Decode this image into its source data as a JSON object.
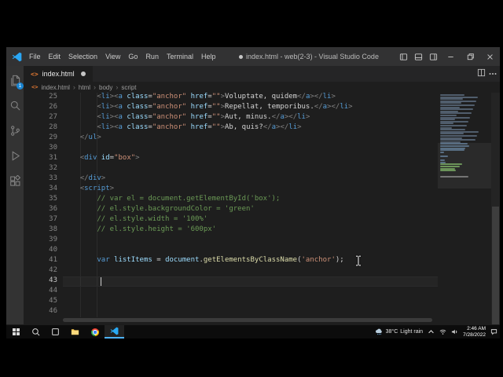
{
  "colors": {
    "accent_blue": "#007acc",
    "badge_blue": "#1a85d2",
    "html_icon_orange": "#e37933",
    "token_tag": "#569cd6",
    "token_attr": "#9cdcfe",
    "token_string": "#ce9178",
    "token_punct": "#808080",
    "token_plain": "#d4d4d4",
    "token_comment": "#6a9955",
    "token_keyword": "#569cd6",
    "token_variable": "#9cdcfe",
    "token_function": "#dcdcaa"
  },
  "window": {
    "title": "index.html - web(2-3) - Visual Studio Code"
  },
  "menu_bar": [
    "File",
    "Edit",
    "Selection",
    "View",
    "Go",
    "Run",
    "Terminal",
    "Help"
  ],
  "titlebar_icons": [
    "toggle-sidebar",
    "toggle-panel",
    "toggle-secondary-sidebar",
    "minimize",
    "restore",
    "close"
  ],
  "activity_bar": [
    {
      "name": "explorer",
      "badge": "1"
    },
    {
      "name": "search"
    },
    {
      "name": "source-control"
    },
    {
      "name": "run-and-debug"
    },
    {
      "name": "extensions"
    }
  ],
  "tab": {
    "label": "index.html"
  },
  "tab_actions": [
    "split-editor",
    "more-actions"
  ],
  "icons": {
    "html_file_glyph": "<>"
  },
  "breadcrumb": [
    "index.html",
    "html",
    "body",
    "script"
  ],
  "breadcrumb_separator": "›",
  "editor": {
    "active_line": 43,
    "lines": [
      {
        "n": 25,
        "tk": [
          [
            "        ",
            "pl"
          ],
          [
            "<",
            "pu"
          ],
          [
            "li",
            "tg"
          ],
          [
            ">",
            "pu"
          ],
          [
            "<",
            "pu"
          ],
          [
            "a",
            "tg"
          ],
          [
            " ",
            "pl"
          ],
          [
            "class",
            "at"
          ],
          [
            "=",
            "pl"
          ],
          [
            "\"anchor\"",
            "st"
          ],
          [
            " ",
            "pl"
          ],
          [
            "href",
            "at"
          ],
          [
            "=",
            "pl"
          ],
          [
            "\"\"",
            "st"
          ],
          [
            ">",
            "pu"
          ],
          [
            "Voluptate, quidem",
            "pl"
          ],
          [
            "</",
            "pu"
          ],
          [
            "a",
            "tg"
          ],
          [
            ">",
            "pu"
          ],
          [
            "</",
            "pu"
          ],
          [
            "li",
            "tg"
          ],
          [
            ">",
            "pu"
          ]
        ]
      },
      {
        "n": 26,
        "tk": [
          [
            "        ",
            "pl"
          ],
          [
            "<",
            "pu"
          ],
          [
            "li",
            "tg"
          ],
          [
            ">",
            "pu"
          ],
          [
            "<",
            "pu"
          ],
          [
            "a",
            "tg"
          ],
          [
            " ",
            "pl"
          ],
          [
            "class",
            "at"
          ],
          [
            "=",
            "pl"
          ],
          [
            "\"anchor\"",
            "st"
          ],
          [
            " ",
            "pl"
          ],
          [
            "href",
            "at"
          ],
          [
            "=",
            "pl"
          ],
          [
            "\"\"",
            "st"
          ],
          [
            ">",
            "pu"
          ],
          [
            "Repellat, temporibus.",
            "pl"
          ],
          [
            "</",
            "pu"
          ],
          [
            "a",
            "tg"
          ],
          [
            ">",
            "pu"
          ],
          [
            "</",
            "pu"
          ],
          [
            "li",
            "tg"
          ],
          [
            ">",
            "pu"
          ]
        ]
      },
      {
        "n": 27,
        "tk": [
          [
            "        ",
            "pl"
          ],
          [
            "<",
            "pu"
          ],
          [
            "li",
            "tg"
          ],
          [
            ">",
            "pu"
          ],
          [
            "<",
            "pu"
          ],
          [
            "a",
            "tg"
          ],
          [
            " ",
            "pl"
          ],
          [
            "class",
            "at"
          ],
          [
            "=",
            "pl"
          ],
          [
            "\"anchor\"",
            "st"
          ],
          [
            " ",
            "pl"
          ],
          [
            "href",
            "at"
          ],
          [
            "=",
            "pl"
          ],
          [
            "\"\"",
            "st"
          ],
          [
            ">",
            "pu"
          ],
          [
            "Aut, minus.",
            "pl"
          ],
          [
            "</",
            "pu"
          ],
          [
            "a",
            "tg"
          ],
          [
            ">",
            "pu"
          ],
          [
            "</",
            "pu"
          ],
          [
            "li",
            "tg"
          ],
          [
            ">",
            "pu"
          ]
        ]
      },
      {
        "n": 28,
        "tk": [
          [
            "        ",
            "pl"
          ],
          [
            "<",
            "pu"
          ],
          [
            "li",
            "tg"
          ],
          [
            ">",
            "pu"
          ],
          [
            "<",
            "pu"
          ],
          [
            "a",
            "tg"
          ],
          [
            " ",
            "pl"
          ],
          [
            "class",
            "at"
          ],
          [
            "=",
            "pl"
          ],
          [
            "\"anchor\"",
            "st"
          ],
          [
            " ",
            "pl"
          ],
          [
            "href",
            "at"
          ],
          [
            "=",
            "pl"
          ],
          [
            "\"\"",
            "st"
          ],
          [
            ">",
            "pu"
          ],
          [
            "Ab, quis?",
            "pl"
          ],
          [
            "</",
            "pu"
          ],
          [
            "a",
            "tg"
          ],
          [
            ">",
            "pu"
          ],
          [
            "</",
            "pu"
          ],
          [
            "li",
            "tg"
          ],
          [
            ">",
            "pu"
          ]
        ]
      },
      {
        "n": 29,
        "tk": [
          [
            "    ",
            "pl"
          ],
          [
            "</",
            "pu"
          ],
          [
            "ul",
            "tg"
          ],
          [
            ">",
            "pu"
          ]
        ]
      },
      {
        "n": 30,
        "tk": []
      },
      {
        "n": 31,
        "tk": [
          [
            "    ",
            "pl"
          ],
          [
            "<",
            "pu"
          ],
          [
            "div",
            "tg"
          ],
          [
            " ",
            "pl"
          ],
          [
            "id",
            "at"
          ],
          [
            "=",
            "pl"
          ],
          [
            "\"box\"",
            "st"
          ],
          [
            ">",
            "pu"
          ]
        ]
      },
      {
        "n": 32,
        "tk": []
      },
      {
        "n": 33,
        "tk": [
          [
            "    ",
            "pl"
          ],
          [
            "</",
            "pu"
          ],
          [
            "div",
            "tg"
          ],
          [
            ">",
            "pu"
          ]
        ]
      },
      {
        "n": 34,
        "tk": [
          [
            "    ",
            "pl"
          ],
          [
            "<",
            "pu"
          ],
          [
            "script",
            "tg"
          ],
          [
            ">",
            "pu"
          ]
        ]
      },
      {
        "n": 35,
        "tk": [
          [
            "        ",
            "pl"
          ],
          [
            "// var el = document.getElementById('box');",
            "cm"
          ]
        ]
      },
      {
        "n": 36,
        "tk": [
          [
            "        ",
            "pl"
          ],
          [
            "// el.style.backgroundColor = 'green'",
            "cm"
          ]
        ]
      },
      {
        "n": 37,
        "tk": [
          [
            "        ",
            "pl"
          ],
          [
            "// el.style.width = '100%'",
            "cm"
          ]
        ]
      },
      {
        "n": 38,
        "tk": [
          [
            "        ",
            "pl"
          ],
          [
            "// el.style.height = '600px'",
            "cm"
          ]
        ]
      },
      {
        "n": 39,
        "tk": []
      },
      {
        "n": 40,
        "tk": []
      },
      {
        "n": 41,
        "tk": [
          [
            "        ",
            "pl"
          ],
          [
            "var",
            "kw"
          ],
          [
            " ",
            "pl"
          ],
          [
            "listItems",
            "vr"
          ],
          [
            " ",
            "pl"
          ],
          [
            "=",
            "pl"
          ],
          [
            " ",
            "pl"
          ],
          [
            "document",
            "vr"
          ],
          [
            ".",
            "pl"
          ],
          [
            "getElementsByClassName",
            "fn"
          ],
          [
            "(",
            "pl"
          ],
          [
            "'anchor'",
            "st"
          ],
          [
            ")",
            "pl"
          ],
          [
            ";",
            "pl"
          ]
        ]
      },
      {
        "n": 42,
        "tk": []
      },
      {
        "n": 43,
        "tk": []
      },
      {
        "n": 44,
        "tk": []
      },
      {
        "n": 45,
        "tk": []
      },
      {
        "n": 46,
        "tk": []
      }
    ]
  },
  "minimap": {
    "total_lines": 46,
    "viewport_start_line": 25,
    "viewport_line_count": 22
  },
  "taskbar": {
    "apps": [
      "start",
      "search",
      "task-view",
      "file-explorer",
      "chrome",
      "vscode"
    ],
    "active_app": "vscode",
    "tray_icons": [
      "chevron-up",
      "network",
      "volume",
      "notification"
    ],
    "weather_temp": "38°C",
    "weather_condition": "Light rain",
    "time": "2:46 AM",
    "date": "7/28/2022"
  }
}
